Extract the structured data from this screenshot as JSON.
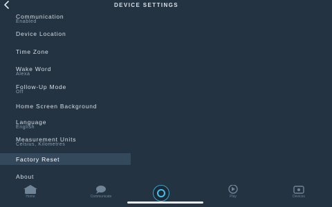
{
  "header": {
    "title": "DEVICE SETTINGS"
  },
  "settings": [
    {
      "label": "Communication",
      "value": "Enabled"
    },
    {
      "label": "Device Location",
      "value": ""
    },
    {
      "label": "Time Zone",
      "value": ""
    },
    {
      "label": "Wake Word",
      "value": "Alexa"
    },
    {
      "label": "Follow-Up Mode",
      "value": "Off"
    },
    {
      "label": "Home Screen Background",
      "value": ""
    },
    {
      "label": "Language",
      "value": "English"
    },
    {
      "label": "Measurement Units",
      "value": "Celsius, Kilometres"
    },
    {
      "label": "Factory Reset",
      "value": ""
    },
    {
      "label": "About",
      "value": ""
    }
  ],
  "selected_item": "Factory Reset",
  "bottom_nav": [
    {
      "label": "Home",
      "icon": "home-icon"
    },
    {
      "label": "Communicate",
      "icon": "chat-icon"
    },
    {
      "label": "Alexa",
      "icon": "alexa-icon"
    },
    {
      "label": "Play",
      "icon": "play-icon"
    },
    {
      "label": "Devices",
      "icon": "devices-icon"
    }
  ],
  "colors": {
    "background": "#243342",
    "selected_row": "#34495c",
    "accent": "#3fc3ee"
  }
}
